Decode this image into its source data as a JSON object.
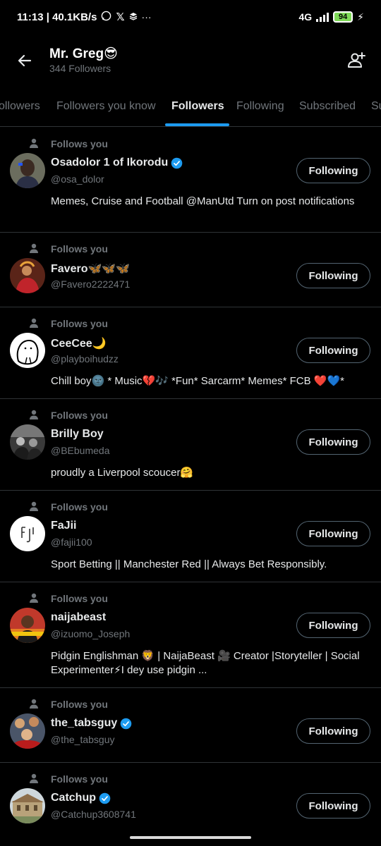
{
  "status_bar": {
    "time": "11:13 | 40.1KB/s",
    "icons": [
      "whatsapp-icon",
      "x-icon",
      "layers-icon",
      "more-icon"
    ],
    "network": "4G",
    "battery": "94"
  },
  "header": {
    "title": "Mr. Greg😎",
    "subtitle": "344 Followers"
  },
  "tabs": [
    {
      "label": "ollowers"
    },
    {
      "label": "Followers you know"
    },
    {
      "label": "Followers",
      "active": true
    },
    {
      "label": "Following"
    },
    {
      "label": "Subscribed"
    },
    {
      "label": "Su"
    }
  ],
  "follows_label": "Follows you",
  "button_label": "Following",
  "users": [
    {
      "name": "Osadolor 1 of Ikorodu",
      "handle": "@osa_dolor",
      "verified": true,
      "bio": "Memes, Cruise and Football @ManUtd  Turn on post notifications",
      "avatar_color": "#6b6d5e"
    },
    {
      "name": "Favero🦋🦋🦋",
      "handle": "@Favero2222471",
      "verified": false,
      "bio": "",
      "avatar_color": "#8a3b2a"
    },
    {
      "name": "CeeCee🌙",
      "handle": "@playboihudzz",
      "verified": false,
      "bio": "Chill boy🌚 * Music💔🎶 *Fun* Sarcarm* Memes* FCB ❤️💙*",
      "avatar_color": "#ffffff"
    },
    {
      "name": "Brilly Boy",
      "handle": "@BEbumeda",
      "verified": false,
      "bio": "proudly a Liverpool scoucer🤗",
      "avatar_color": "#3a3a3a"
    },
    {
      "name": "FaJii",
      "handle": "@fajii100",
      "verified": false,
      "bio": "Sport Betting || Manchester Red || Always Bet Responsibly.",
      "avatar_color": "#ffffff"
    },
    {
      "name": "naijabeast",
      "handle": "@izuomo_Joseph",
      "verified": false,
      "bio": "Pidgin Englishman 🦁 | NaijaBeast 🎥 Creator |Storyteller | Social Experimenter⚡I dey use pidgin ...",
      "avatar_color": "#c0392b"
    },
    {
      "name": "the_tabsguy",
      "handle": "@the_tabsguy",
      "verified": true,
      "bio": "",
      "avatar_color": "#4a5568"
    },
    {
      "name": "Catchup",
      "handle": "@Catchup3608741",
      "verified": true,
      "bio": "",
      "avatar_color": "#b8a27a"
    }
  ]
}
